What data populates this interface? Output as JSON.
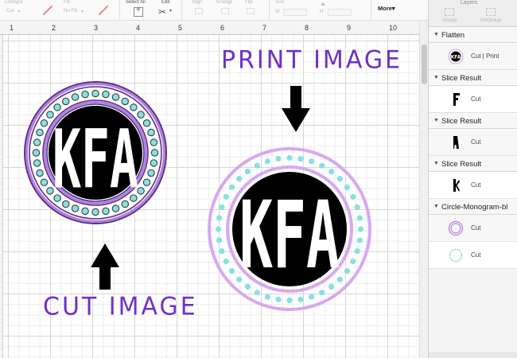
{
  "toolbar": {
    "linetype_label": "Linetype",
    "linetype_value": "Cut",
    "fill_label": "Fill",
    "fill_value": "No Fill",
    "select_all_label": "Select All",
    "edit_label": "Edit",
    "align_label": "Align",
    "arrange_label": "Arrange",
    "flip_label": "Flip",
    "size_label": "Size",
    "size_w_label": "W",
    "size_h_label": "H",
    "more_label": "More"
  },
  "ruler": {
    "numbers": [
      "1",
      "2",
      "3",
      "4",
      "5",
      "6",
      "7",
      "8",
      "9",
      "10"
    ]
  },
  "canvas": {
    "print_label": "PRINT IMAGE",
    "cut_label": "CUT IMAGE",
    "monogram_text": "KFA",
    "colors": {
      "label": "#7030c8",
      "purple_ring": "#a374d8",
      "lavender_ring": "#d8a8ef",
      "teal_dot": "#88e0e4",
      "monogram": "#000000"
    }
  },
  "panel": {
    "tools": {
      "group_label": "Group",
      "ungroup_label": "UnGroup"
    },
    "tab_label": "Layers",
    "groups": [
      {
        "name": "Flatten",
        "layers": [
          {
            "name": "Cut  |  Print"
          }
        ]
      },
      {
        "name": "Slice Result",
        "layers": [
          {
            "name": "Cut"
          }
        ]
      },
      {
        "name": "Slice Result",
        "layers": [
          {
            "name": "Cut"
          }
        ]
      },
      {
        "name": "Slice Result",
        "layers": [
          {
            "name": "Cut"
          }
        ]
      },
      {
        "name": "Circle-Monogram-bl",
        "layers": [
          {
            "name": "Cut"
          },
          {
            "name": "Cut"
          }
        ]
      }
    ]
  }
}
